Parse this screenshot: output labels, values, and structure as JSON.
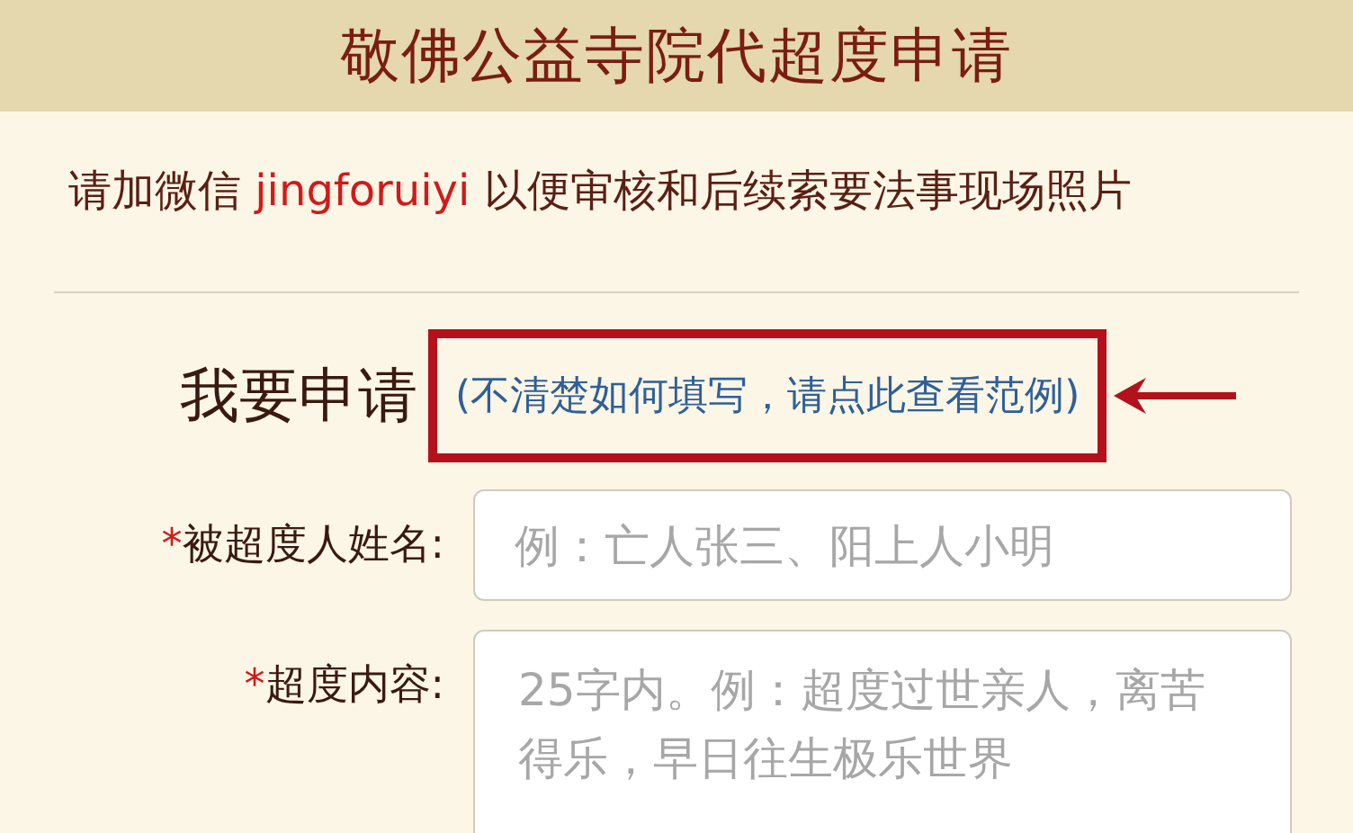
{
  "header": {
    "title": "敬佛公益寺院代超度申请"
  },
  "notice": {
    "before": "请加微信 ",
    "wechat_id": "jingforuiyi",
    "after": " 以便审核和后续索要法事现场照片"
  },
  "apply": {
    "heading": "我要申请",
    "example_link": "(不清楚如何填写，请点此查看范例)",
    "highlighted": true
  },
  "fields": [
    {
      "kind": "input",
      "required": true,
      "marker": "*",
      "label": "被超度人姓名:",
      "placeholder": "例：亡人张三、阳上人小明"
    },
    {
      "kind": "textarea",
      "required": true,
      "marker": "*",
      "label": "超度内容:",
      "placeholder": "25字内。例：超度过世亲人，离苦得乐，早日往生极乐世界"
    }
  ]
}
